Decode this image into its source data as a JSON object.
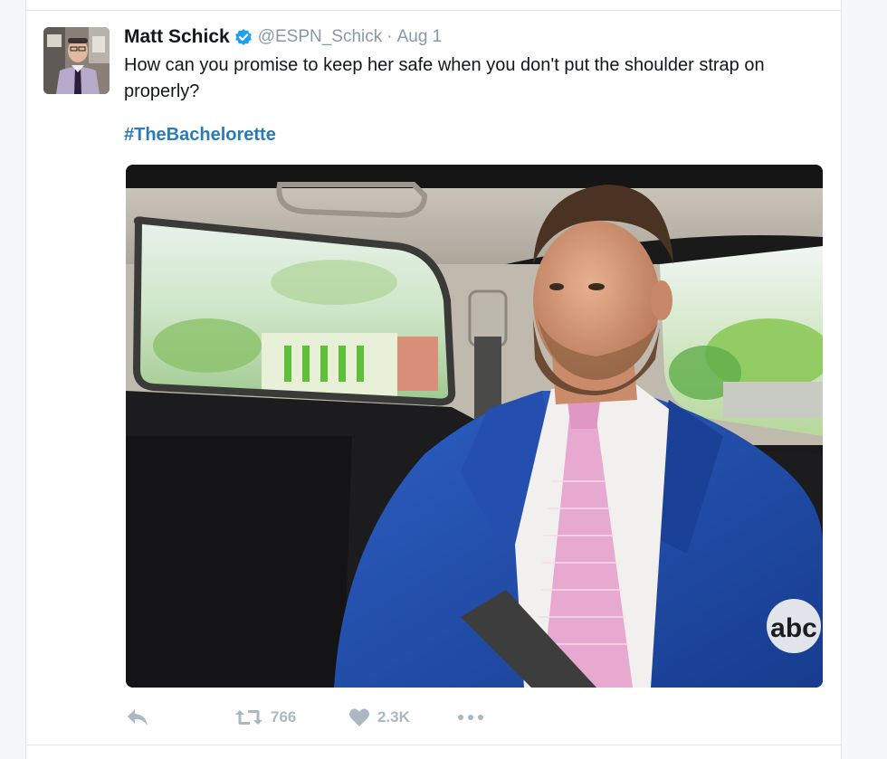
{
  "tweet": {
    "author_name": "Matt Schick",
    "handle": "@ESPN_Schick",
    "separator": "·",
    "date": "Aug 1",
    "text": "How can you promise to keep her safe when you don't put the shoulder strap on properly?",
    "hashtag": "#TheBachelorette",
    "verified": true
  },
  "media": {
    "watermark": "abc"
  },
  "actions": {
    "reply_icon": "reply-icon",
    "retweet_icon": "retweet-icon",
    "retweet_count": "766",
    "like_icon": "heart-icon",
    "like_count": "2.3K",
    "more_icon": "more-dots-icon"
  },
  "colors": {
    "link": "#2b7bb9",
    "verified": "#1da1f2",
    "muted": "#8899a6",
    "action_gray": "#aab8c2",
    "text": "#14171a"
  }
}
